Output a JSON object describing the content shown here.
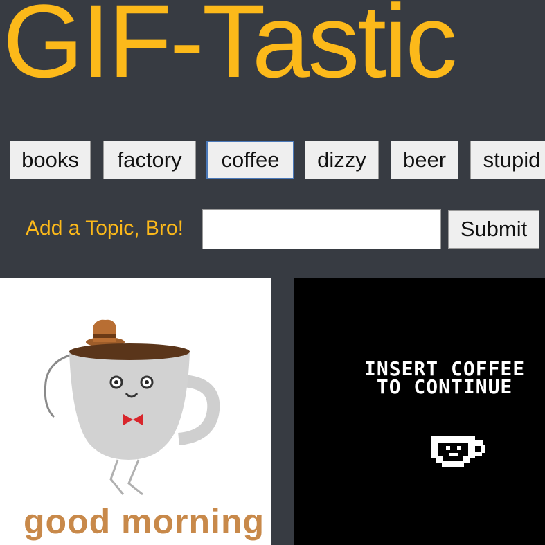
{
  "colors": {
    "title": "#fcb91a",
    "background": "#373b42",
    "caption": "#c8894a",
    "focus": "#4a78b8"
  },
  "header": {
    "title": "GIF-Tastic"
  },
  "topics": [
    "books",
    "factory",
    "coffee",
    "dizzy",
    "beer",
    "stupid"
  ],
  "focused_topic": "coffee",
  "form": {
    "label": "Add a Topic, Bro!",
    "input_value": "",
    "submit_label": "Submit"
  },
  "gifs": [
    {
      "caption": "good morning",
      "subject": "coffee-cup-character"
    },
    {
      "line1": "INSERT COFFEE",
      "line2": "TO CONTINUE",
      "subject": "pixel-coffee-cup"
    }
  ]
}
